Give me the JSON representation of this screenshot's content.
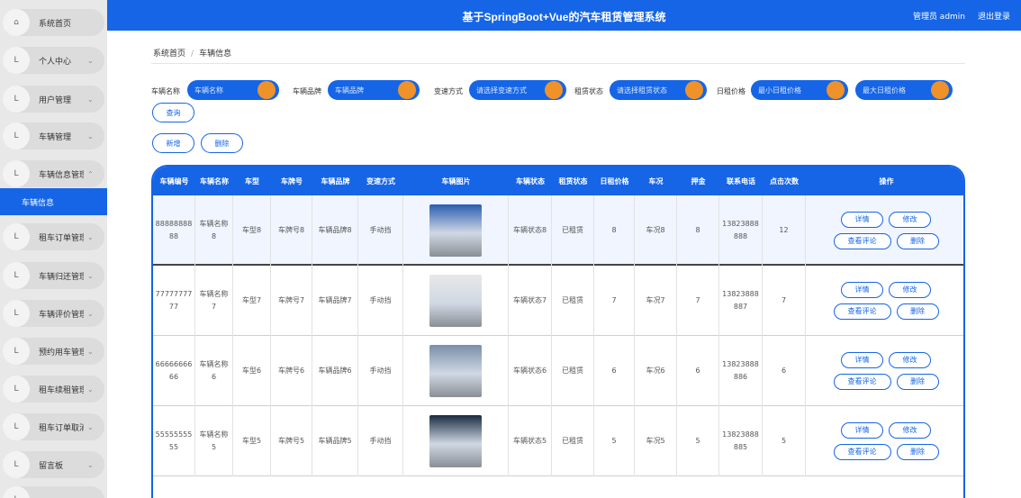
{
  "app": {
    "title": "基于SpringBoot+Vue的汽车租赁管理系统",
    "user": "管理员 admin",
    "logout": "退出登录"
  },
  "sidebar": {
    "items": [
      {
        "label": "系统首页",
        "icon": "home-icon"
      },
      {
        "label": "个人中心",
        "icon": "user-icon"
      },
      {
        "label": "用户管理",
        "icon": "users-icon"
      },
      {
        "label": "车辆管理",
        "icon": "car-icon"
      },
      {
        "label": "车辆信息管理",
        "icon": "list-icon"
      },
      {
        "label": "租车订单管理",
        "icon": "order-icon"
      },
      {
        "label": "车辆归还管理",
        "icon": "return-icon"
      },
      {
        "label": "车辆评价管理",
        "icon": "star-icon"
      },
      {
        "label": "预约用车管理",
        "icon": "calendar-icon"
      },
      {
        "label": "租车续租管理",
        "icon": "renew-icon"
      },
      {
        "label": "租车订单取消",
        "icon": "cancel-icon"
      },
      {
        "label": "留言板",
        "icon": "message-icon"
      }
    ],
    "active_sub": "车辆信息"
  },
  "breadcrumb": {
    "home": "系统首页",
    "current": "车辆信息"
  },
  "filters": {
    "car_name": {
      "label": "车辆名称",
      "placeholder": "车辆名称"
    },
    "brand": {
      "label": "车辆品牌",
      "placeholder": "车辆品牌"
    },
    "transmission": {
      "label": "变速方式",
      "placeholder": "请选择变速方式"
    },
    "status": {
      "label": "租赁状态",
      "placeholder": "请选择租赁状态"
    },
    "price": {
      "label": "日租价格",
      "min_placeholder": "最小日租价格",
      "max_placeholder": "最大日租价格"
    },
    "search_label": "查询"
  },
  "actions": {
    "add": "新增",
    "delete": "删除"
  },
  "table": {
    "headers": [
      "车辆编号",
      "车辆名称",
      "车型",
      "车牌号",
      "车辆品牌",
      "变速方式",
      "车辆图片",
      "车辆状态",
      "租赁状态",
      "日租价格",
      "车况",
      "押金",
      "联系电话",
      "点击次数",
      "操作"
    ],
    "row_actions": {
      "detail": "详情",
      "edit": "修改",
      "review": "查看评论",
      "delete": "删除"
    },
    "rows": [
      {
        "id": "8888888888",
        "name": "车辆名称8",
        "model": "车型8",
        "plate": "车牌号8",
        "brand": "车辆品牌8",
        "trans": "手动挡",
        "img_color": "#2a5db0",
        "car_status": "车辆状态8",
        "rent_status": "已租赁",
        "price": "8",
        "cond": "车况8",
        "deposit": "8",
        "phone": "13823888888",
        "clicks": "12"
      },
      {
        "id": "7777777777",
        "name": "车辆名称7",
        "model": "车型7",
        "plate": "车牌号7",
        "brand": "车辆品牌7",
        "trans": "手动挡",
        "img_color": "#e8e8e8",
        "car_status": "车辆状态7",
        "rent_status": "已租赁",
        "price": "7",
        "cond": "车况7",
        "deposit": "7",
        "phone": "13823888887",
        "clicks": "7"
      },
      {
        "id": "6666666666",
        "name": "车辆名称6",
        "model": "车型6",
        "plate": "车牌号6",
        "brand": "车辆品牌6",
        "trans": "手动挡",
        "img_color": "#7a8fa8",
        "car_status": "车辆状态6",
        "rent_status": "已租赁",
        "price": "6",
        "cond": "车况6",
        "deposit": "6",
        "phone": "13823888886",
        "clicks": "6"
      },
      {
        "id": "5555555555",
        "name": "车辆名称5",
        "model": "车型5",
        "plate": "车牌号5",
        "brand": "车辆品牌5",
        "trans": "手动挡",
        "img_color": "#1a2b40",
        "car_status": "车辆状态5",
        "rent_status": "已租赁",
        "price": "5",
        "cond": "车况5",
        "deposit": "5",
        "phone": "13823888885",
        "clicks": "5"
      }
    ]
  }
}
